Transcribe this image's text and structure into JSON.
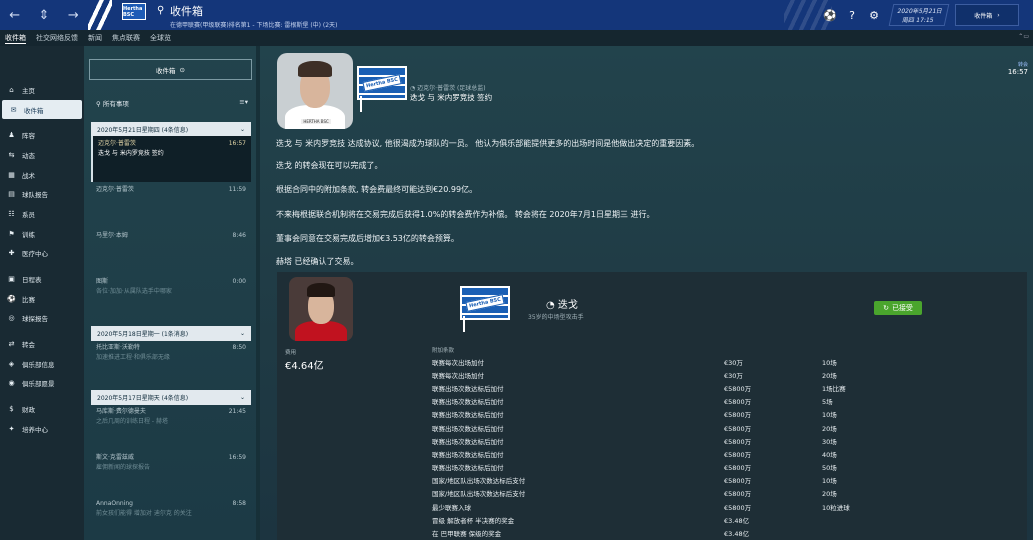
{
  "topbar": {
    "title": "收件箱",
    "subtitle": "在德甲联赛(甲级联赛)排名第1 - 下场比赛: 雷根斯堡 (中) (2天)",
    "club_badge": "Hertha BSC",
    "date_line1": "2020年5月21日",
    "date_line2": "周四 17:15",
    "inbox_button": "收件箱",
    "icons": [
      "back-icon",
      "forward-icon",
      "search-icon",
      "ball-icon",
      "help-icon",
      "gear-icon"
    ]
  },
  "tabs": [
    "收件箱",
    "社交网络反馈",
    "新闻",
    "焦点联赛",
    "全球览"
  ],
  "sidebar": {
    "items": [
      {
        "label": "主页",
        "icon": "⌂"
      },
      {
        "label": "收件箱",
        "icon": "✉"
      },
      {
        "label": "阵容",
        "icon": "♟"
      },
      {
        "label": "动态",
        "icon": "⇆"
      },
      {
        "label": "战术",
        "icon": "▦"
      },
      {
        "label": "球队报告",
        "icon": "▤"
      },
      {
        "label": "系员",
        "icon": "☷"
      },
      {
        "label": "训练",
        "icon": "⚑"
      },
      {
        "label": "医疗中心",
        "icon": "✚"
      },
      {
        "label": "日程表",
        "icon": "▣"
      },
      {
        "label": "比赛",
        "icon": "⚽"
      },
      {
        "label": "球探报告",
        "icon": "◎"
      },
      {
        "label": "转会",
        "icon": "⇄"
      },
      {
        "label": "俱乐部信息",
        "icon": "◈"
      },
      {
        "label": "俱乐部愿景",
        "icon": "◉"
      },
      {
        "label": "财政",
        "icon": "$"
      },
      {
        "label": "培养中心",
        "icon": "✦"
      }
    ]
  },
  "msglist": {
    "inbox_label": "收件箱",
    "filter_label": "所有事项",
    "groups": [
      {
        "header": "2020年5月21日星期四 (4条信息)",
        "messages": [
          {
            "from": "迈克尔·普雷茨",
            "time": "16:57",
            "subject": "迭戈 与 米内罗竞技 签约",
            "selected": true
          },
          {
            "from": "迈克尔·普雷茨",
            "time": "11:59",
            "subject": ""
          },
          {
            "from": "马里尔·本姆",
            "time": "8:46",
            "subject": ""
          },
          {
            "from": "图斯",
            "time": "0:00",
            "subject": "各位·加加·从属队选手中哪家"
          }
        ]
      },
      {
        "header": "2020年5月18日星期一 (1条消息)",
        "messages": [
          {
            "from": "托比亚斯·沃勒特",
            "time": "8:50",
            "subject": "加速推进工程·和俱乐部无缘"
          }
        ]
      },
      {
        "header": "2020年5月17日星期天 (4条信息)",
        "messages": [
          {
            "from": "马库斯·费尔德曼夫",
            "time": "21:45",
            "subject": "之后几周的训练日程 - 赫塔"
          },
          {
            "from": "斯文·克雷兹威",
            "time": "16:59",
            "subject": "雇佣新闻的球探报告"
          },
          {
            "from": "AnnaOnning",
            "time": "8:58",
            "subject": "前女孩们能得 增加对 迪尔克 的关注"
          }
        ]
      }
    ]
  },
  "message": {
    "sender": "迈克尔·普雷茨 (足球总监)",
    "subject": "迭戈 与 米内罗竞技 签约",
    "time_label": "转会",
    "time": "16:57",
    "paragraphs": [
      "迭戈 与 米内罗竞技 达成协议, 他很渴成为球队的一员。 他认为俱乐部能提供更多的出场时间是他做出决定的重要因素。",
      "迭戈 的转会现在可以完成了。",
      "根据合同中的附加条款, 转会费最终可能达到€20.99亿。",
      "不来梅根据联合机制将在交易完成后获得1.0%的转会费作为补偿。 转会将在 2020年7月1日星期三 进行。",
      "董事会同意在交易完成后增加€3.53亿的转会预算。",
      "赫塔 已经确认了交易。"
    ]
  },
  "card": {
    "player_name": "迭戈",
    "player_desc": "35岁的中场型攻击手",
    "status": "已接受",
    "fee_label": "费用",
    "fee_value": "€4.64亿",
    "clauses_label": "附加条款",
    "clauses": [
      {
        "name": "联赛每次出场加付",
        "amount": "€30万",
        "cond": "10场"
      },
      {
        "name": "联赛每次出场加付",
        "amount": "€30万",
        "cond": "20场"
      },
      {
        "name": "联赛出场次数达标后加付",
        "amount": "€5800万",
        "cond": "1场比赛"
      },
      {
        "name": "联赛出场次数达标后加付",
        "amount": "€5800万",
        "cond": "5场"
      },
      {
        "name": "联赛出场次数达标后加付",
        "amount": "€5800万",
        "cond": "10场"
      },
      {
        "name": "联赛出场次数达标后加付",
        "amount": "€5800万",
        "cond": "20场"
      },
      {
        "name": "联赛出场次数达标后加付",
        "amount": "€5800万",
        "cond": "30场"
      },
      {
        "name": "联赛出场次数达标后加付",
        "amount": "€5800万",
        "cond": "40场"
      },
      {
        "name": "联赛出场次数达标后加付",
        "amount": "€5800万",
        "cond": "50场"
      },
      {
        "name": "国家/地区队出场次数达标后支付",
        "amount": "€5800万",
        "cond": "10场"
      },
      {
        "name": "国家/地区队出场次数达标后支付",
        "amount": "€5800万",
        "cond": "20场"
      },
      {
        "name": "最少联赛入球",
        "amount": "€5800万",
        "cond": "10粒进球"
      },
      {
        "name": "冒级 解放者杯 半决赛的奖金",
        "amount": "€3.48亿",
        "cond": ""
      },
      {
        "name": "在 巴甲联赛 保级的奖金",
        "amount": "€3.48亿",
        "cond": ""
      }
    ]
  },
  "colors": {
    "topbar": "#14367a",
    "accepted": "#4aa52d",
    "panel": "#22434c"
  }
}
